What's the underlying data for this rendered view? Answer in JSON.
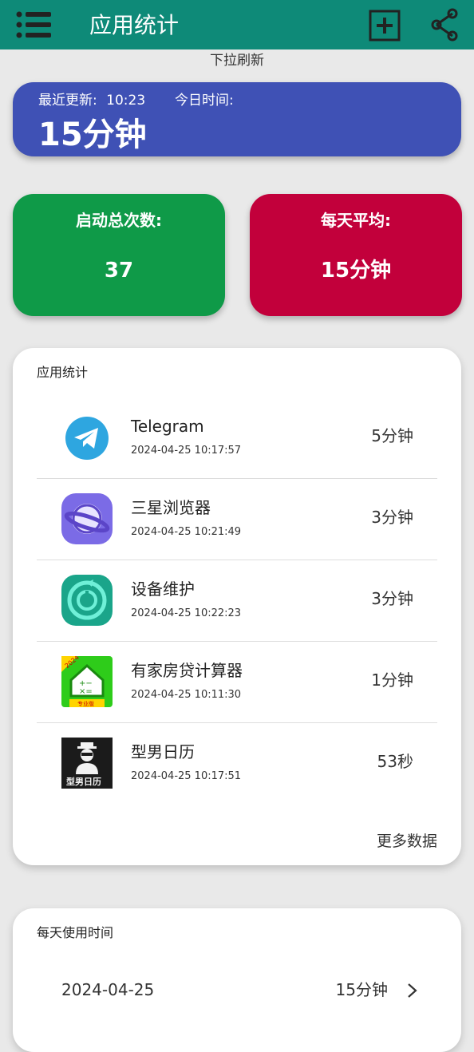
{
  "appbar": {
    "title": "应用统计",
    "menu_icon": "menu-icon",
    "add_icon": "add-box-icon",
    "share_icon": "share-icon",
    "color": "#0e8a78"
  },
  "pull_hint": "下拉刷新",
  "summary": {
    "last_update_label": "最近更新:",
    "last_update_value": "10:23",
    "today_label": "今日时间:",
    "today_value": "15分钟",
    "color": "#3f51b5"
  },
  "stats": {
    "launch_label": "启动总次数:",
    "launch_value": "37",
    "launch_color": "#0f9a48",
    "daily_avg_label": "每天平均:",
    "daily_avg_value": "15分钟",
    "daily_avg_color": "#c2003b"
  },
  "apps_card": {
    "header": "应用统计",
    "items": [
      {
        "name": "Telegram",
        "time": "2024-04-25 10:17:57",
        "duration": "5分钟",
        "icon": "telegram-icon"
      },
      {
        "name": "三星浏览器",
        "time": "2024-04-25 10:21:49",
        "duration": "3分钟",
        "icon": "samsung-browser-icon"
      },
      {
        "name": "设备维护",
        "time": "2024-04-25 10:22:23",
        "duration": "3分钟",
        "icon": "device-care-icon"
      },
      {
        "name": "有家房贷计算器",
        "time": "2024-04-25 10:11:30",
        "duration": "1分钟",
        "icon": "mortgage-calculator-icon"
      },
      {
        "name": "型男日历",
        "time": "2024-04-25 10:17:51",
        "duration": "53秒",
        "icon": "calendar-app-icon"
      }
    ],
    "more_label": "更多数据"
  },
  "daily_card": {
    "header": "每天使用时间",
    "rows": [
      {
        "date": "2024-04-25",
        "duration": "15分钟"
      }
    ]
  },
  "icon_texts": {
    "mortgage_badge": "2024",
    "mortgage_ribbon": "专业版",
    "calendar_text": "型男日历"
  }
}
